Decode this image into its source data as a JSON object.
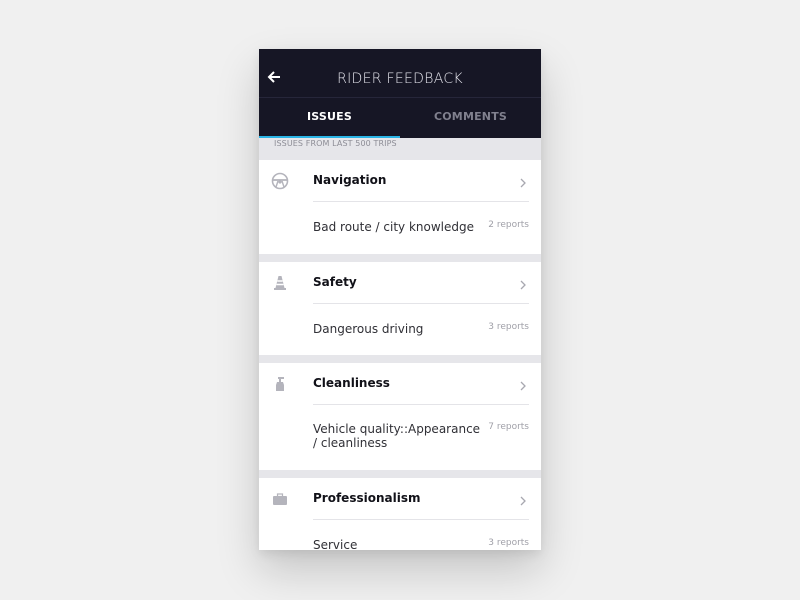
{
  "header": {
    "title": "RIDER FEEDBACK",
    "back_icon": "arrow-left-icon"
  },
  "tabs": [
    {
      "label": "ISSUES",
      "active": true
    },
    {
      "label": "COMMENTS",
      "active": false
    }
  ],
  "colors": {
    "header_bg": "#161625",
    "tab_indicator": "#2ab4e6",
    "page_bg": "#e6e6ea"
  },
  "subheader": "ISSUES FROM LAST 500 TRIPS",
  "categories": [
    {
      "title": "Navigation",
      "icon": "steering-wheel-icon",
      "issue": "Bad route / city knowledge",
      "reports": "2 reports"
    },
    {
      "title": "Safety",
      "icon": "traffic-cone-icon",
      "issue": "Dangerous driving",
      "reports": "3 reports"
    },
    {
      "title": "Cleanliness",
      "icon": "spray-bottle-icon",
      "issue": "Vehicle quality::Appearance / cleanliness",
      "reports": "7 reports"
    },
    {
      "title": "Professionalism",
      "icon": "briefcase-icon",
      "issue": "Service",
      "reports": "3 reports"
    }
  ]
}
